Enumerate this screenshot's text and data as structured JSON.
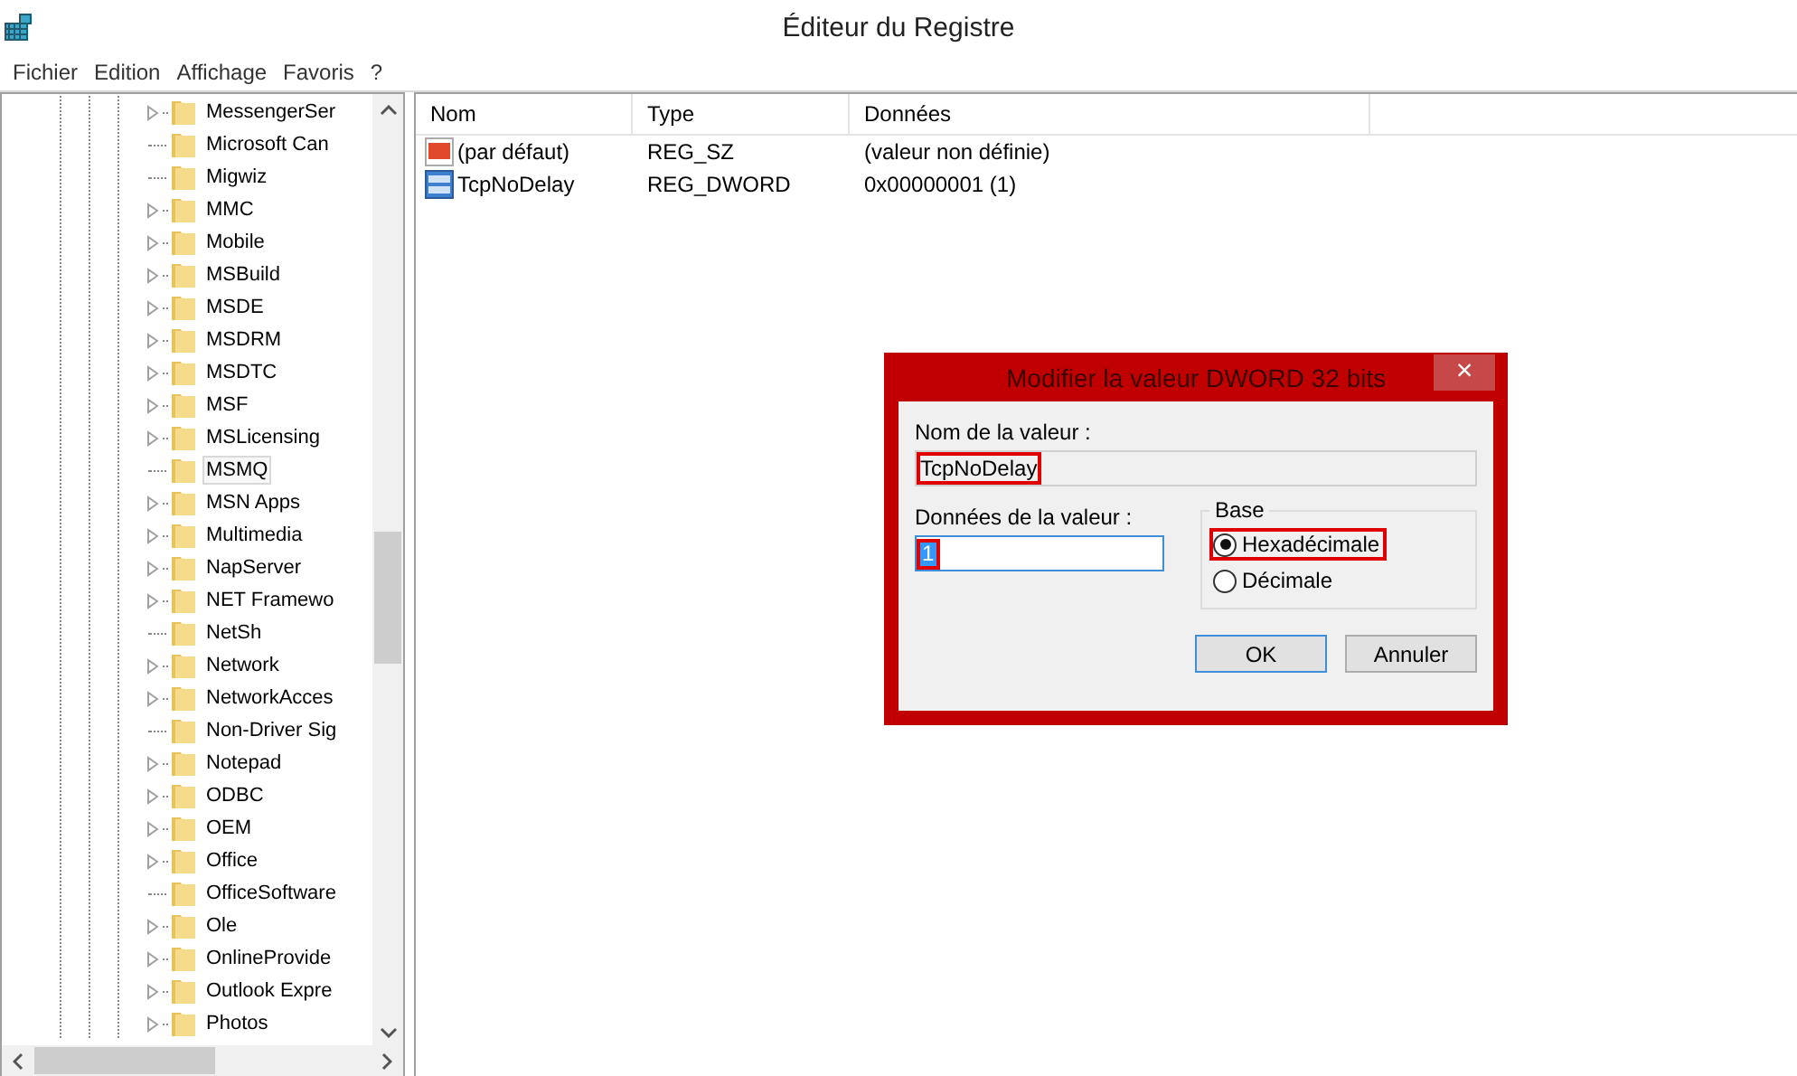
{
  "window": {
    "title": "Éditeur du Registre"
  },
  "menu": [
    "Fichier",
    "Edition",
    "Affichage",
    "Favoris",
    "?"
  ],
  "tree": [
    {
      "name": "MessengerSer",
      "expandable": true,
      "selected": false
    },
    {
      "name": "Microsoft Can",
      "expandable": false,
      "selected": false
    },
    {
      "name": "Migwiz",
      "expandable": false,
      "selected": false
    },
    {
      "name": "MMC",
      "expandable": true,
      "selected": false
    },
    {
      "name": "Mobile",
      "expandable": true,
      "selected": false
    },
    {
      "name": "MSBuild",
      "expandable": true,
      "selected": false
    },
    {
      "name": "MSDE",
      "expandable": true,
      "selected": false
    },
    {
      "name": "MSDRM",
      "expandable": true,
      "selected": false
    },
    {
      "name": "MSDTC",
      "expandable": true,
      "selected": false
    },
    {
      "name": "MSF",
      "expandable": true,
      "selected": false
    },
    {
      "name": "MSLicensing",
      "expandable": true,
      "selected": false
    },
    {
      "name": "MSMQ",
      "expandable": false,
      "selected": true
    },
    {
      "name": "MSN Apps",
      "expandable": true,
      "selected": false
    },
    {
      "name": "Multimedia",
      "expandable": true,
      "selected": false
    },
    {
      "name": "NapServer",
      "expandable": true,
      "selected": false
    },
    {
      "name": "NET Framewo",
      "expandable": true,
      "selected": false
    },
    {
      "name": "NetSh",
      "expandable": false,
      "selected": false
    },
    {
      "name": "Network",
      "expandable": true,
      "selected": false
    },
    {
      "name": "NetworkAcces",
      "expandable": true,
      "selected": false
    },
    {
      "name": "Non-Driver Sig",
      "expandable": false,
      "selected": false
    },
    {
      "name": "Notepad",
      "expandable": true,
      "selected": false
    },
    {
      "name": "ODBC",
      "expandable": true,
      "selected": false
    },
    {
      "name": "OEM",
      "expandable": true,
      "selected": false
    },
    {
      "name": "Office",
      "expandable": true,
      "selected": false
    },
    {
      "name": "OfficeSoftware",
      "expandable": false,
      "selected": false
    },
    {
      "name": "Ole",
      "expandable": true,
      "selected": false
    },
    {
      "name": "OnlineProvide",
      "expandable": true,
      "selected": false
    },
    {
      "name": "Outlook Expre",
      "expandable": true,
      "selected": false
    },
    {
      "name": "Photos",
      "expandable": true,
      "selected": false
    }
  ],
  "values": {
    "columns": [
      "Nom",
      "Type",
      "Données"
    ],
    "rows": [
      {
        "kind": "string",
        "name": "(par défaut)",
        "type": "REG_SZ",
        "data": "(valeur non définie)"
      },
      {
        "kind": "binary",
        "name": "TcpNoDelay",
        "type": "REG_DWORD",
        "data": "0x00000001 (1)"
      }
    ]
  },
  "dialog": {
    "title": "Modifier la valeur DWORD 32 bits",
    "close": "×",
    "name_label": "Nom de la valeur :",
    "name_value": "TcpNoDelay",
    "name_highlighted": true,
    "data_label": "Données de la valeur :",
    "data_value": "1",
    "data_highlighted": true,
    "base_label": "Base",
    "bases": [
      {
        "label": "Hexadécimale",
        "selected": true,
        "highlighted": true
      },
      {
        "label": "Décimale",
        "selected": false,
        "highlighted": false
      }
    ],
    "buttons": [
      "OK",
      "Annuler"
    ]
  }
}
